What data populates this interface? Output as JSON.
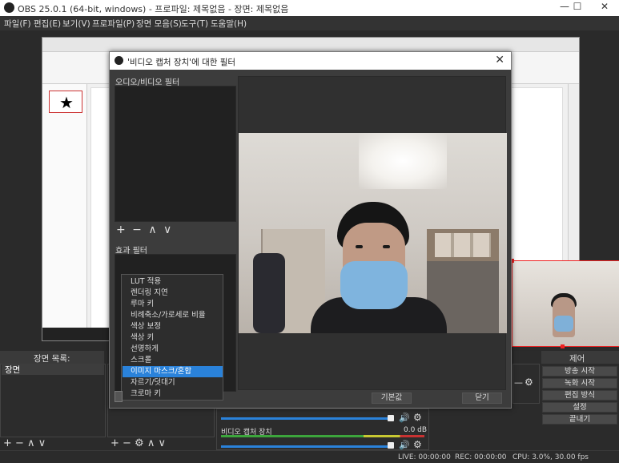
{
  "window": {
    "title": "OBS 25.0.1 (64-bit, windows) - 프로파일: 제목없음 - 장면: 제목없음",
    "minimize": "—",
    "maximize": "☐",
    "close": "✕"
  },
  "menu": [
    "파일(F)",
    "편집(E)",
    "보기(V)",
    "프로파일(P)",
    "장면 모음(S)",
    "도구(T)",
    "도움말(H)"
  ],
  "docks": {
    "scenes": {
      "title": "장면 목록:",
      "items": [
        "장면"
      ]
    },
    "controls": {
      "title": "제어",
      "buttons": [
        "방송 시작",
        "녹화 시작",
        "편집 방식",
        "설정",
        "끝내기"
      ]
    },
    "footer_tools": "+ − ∧ ∨",
    "source_footer_tools": "+ − ⚙ ∧ ∨"
  },
  "mixer": {
    "source_name": "비디오 캡처 장치",
    "db": "0.0 dB"
  },
  "status": {
    "live": "LIVE: 00:00:00",
    "rec": "REC: 00:00:00",
    "cpu": "CPU: 3.0%, 30.00 fps"
  },
  "dialog": {
    "title": "'비디오 캡처 장치'에 대한 필터",
    "close": "✕",
    "audio_video_label": "오디오/비디오 필터",
    "audio_tools": "+ − ∧ ∨",
    "effect_label": "효과 필터",
    "defaults_button": "기본값",
    "close_button": "닫기"
  },
  "dropdown": {
    "items": [
      "LUT 적용",
      "렌더링 지연",
      "루마 키",
      "비례축소/가로세로 비율",
      "색상 보정",
      "색상 키",
      "선명하게",
      "스크롤",
      "이미지 마스크/혼합",
      "자르기/덧대기",
      "크로마 키"
    ],
    "selected_index": 8
  },
  "colors": {
    "accent": "#2a82da",
    "selection_red": "#e22222",
    "mask_blue": "#7fb4de"
  }
}
